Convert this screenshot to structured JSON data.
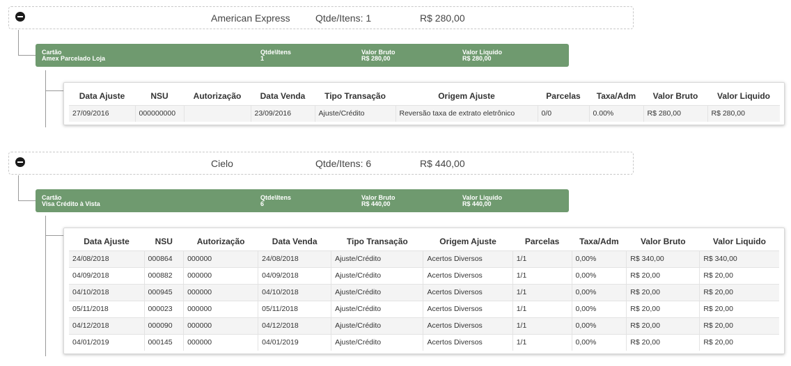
{
  "groups": [
    {
      "summary": {
        "name": "American Express",
        "qtde": "Qtde/Itens: 1",
        "valor": "R$ 280,00"
      },
      "detail": {
        "cartao_label": "Cartão",
        "cartao_value": "Amex Parcelado Loja",
        "qtde_label": "Qtde\\Itens",
        "qtde_value": "1",
        "bruto_label": "Valor Bruto",
        "bruto_value": "R$ 280,00",
        "liquido_label": "Valor Liquido",
        "liquido_value": "R$ 280,00"
      },
      "columns": [
        "Data Ajuste",
        "NSU",
        "Autorização",
        "Data Venda",
        "Tipo Transação",
        "Origem Ajuste",
        "Parcelas",
        "Taxa/Adm",
        "Valor Bruto",
        "Valor Liquido"
      ],
      "rows": [
        [
          "27/09/2016",
          "000000000",
          "",
          "23/09/2016",
          "Ajuste/Crédito",
          "Reversão taxa de extrato eletrônico",
          "0/0",
          "0.00%",
          "R$ 280,00",
          "R$ 280,00"
        ]
      ]
    },
    {
      "summary": {
        "name": "Cielo",
        "qtde": "Qtde/Itens: 6",
        "valor": "R$ 440,00"
      },
      "detail": {
        "cartao_label": "Cartão",
        "cartao_value": "Visa Crédito à Vista",
        "qtde_label": "Qtde\\Itens",
        "qtde_value": "6",
        "bruto_label": "Valor Bruto",
        "bruto_value": "R$ 440,00",
        "liquido_label": "Valor Liquido",
        "liquido_value": "R$ 440,00"
      },
      "columns": [
        "Data Ajuste",
        "NSU",
        "Autorização",
        "Data Venda",
        "Tipo Transação",
        "Origem Ajuste",
        "Parcelas",
        "Taxa/Adm",
        "Valor Bruto",
        "Valor Liquido"
      ],
      "rows": [
        [
          "24/08/2018",
          "000864",
          "000000",
          "24/08/2018",
          "Ajuste/Crédito",
          "Acertos Diversos",
          "1/1",
          "0,00%",
          "R$ 340,00",
          "R$ 340,00"
        ],
        [
          "04/09/2018",
          "000882",
          "000000",
          "04/09/2018",
          "Ajuste/Crédito",
          "Acertos Diversos",
          "1/1",
          "0,00%",
          "R$ 20,00",
          "R$ 20,00"
        ],
        [
          "04/10/2018",
          "000945",
          "000000",
          "04/10/2018",
          "Ajuste/Crédito",
          "Acertos Diversos",
          "1/1",
          "0,00%",
          "R$ 20,00",
          "R$ 20,00"
        ],
        [
          "05/11/2018",
          "000023",
          "000000",
          "05/11/2018",
          "Ajuste/Crédito",
          "Acertos Diversos",
          "1/1",
          "0,00%",
          "R$ 20,00",
          "R$ 20,00"
        ],
        [
          "04/12/2018",
          "000090",
          "000000",
          "04/12/2018",
          "Ajuste/Crédito",
          "Acertos Diversos",
          "1/1",
          "0,00%",
          "R$ 20,00",
          "R$ 20,00"
        ],
        [
          "04/01/2019",
          "000145",
          "000000",
          "04/01/2019",
          "Ajuste/Crédito",
          "Acertos Diversos",
          "1/1",
          "0,00%",
          "R$ 20,00",
          "R$ 20,00"
        ]
      ]
    }
  ]
}
